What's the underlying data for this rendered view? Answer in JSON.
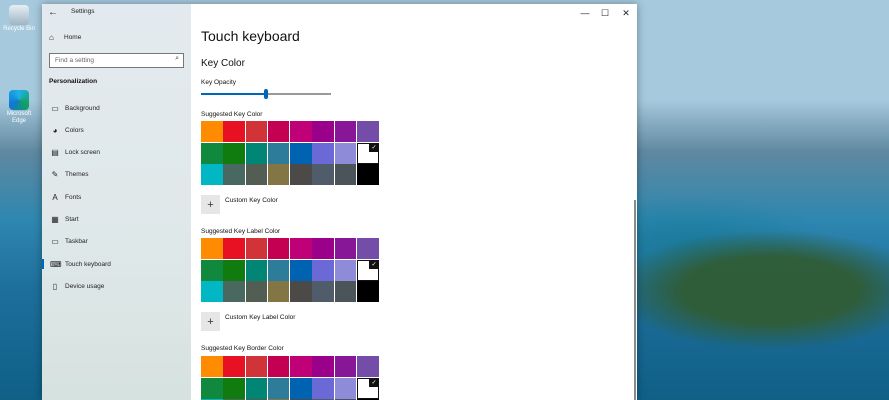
{
  "desktop": {
    "icons": [
      {
        "label": "Recycle Bin",
        "icon": "recycle-bin-icon"
      },
      {
        "label": "Microsoft Edge",
        "icon": "edge-icon"
      }
    ]
  },
  "window": {
    "title": "Settings",
    "controls": {
      "back": "←",
      "minimize": "—",
      "maximize": "☐",
      "close": "✕"
    }
  },
  "sidebar": {
    "home_label": "Home",
    "search_placeholder": "Find a setting",
    "section": "Personalization",
    "items": [
      {
        "label": "Background",
        "icon": "image-icon",
        "glyph": "▭"
      },
      {
        "label": "Colors",
        "icon": "palette-icon",
        "glyph": "◕"
      },
      {
        "label": "Lock screen",
        "icon": "lock-screen-icon",
        "glyph": "▤"
      },
      {
        "label": "Themes",
        "icon": "brush-icon",
        "glyph": "✎"
      },
      {
        "label": "Fonts",
        "icon": "font-icon",
        "glyph": "A"
      },
      {
        "label": "Start",
        "icon": "start-icon",
        "glyph": "▦"
      },
      {
        "label": "Taskbar",
        "icon": "taskbar-icon",
        "glyph": "▭"
      },
      {
        "label": "Touch keyboard",
        "icon": "keyboard-icon",
        "glyph": "⌨",
        "active": true
      },
      {
        "label": "Device usage",
        "icon": "device-icon",
        "glyph": "▯"
      }
    ]
  },
  "main": {
    "title": "Touch keyboard",
    "section_title": "Key Color",
    "opacity_label": "Key Opacity",
    "opacity_value": 0.5,
    "groups": [
      {
        "label": "Suggested Key Color",
        "custom_label": "Custom Key Color"
      },
      {
        "label": "Suggested Key Label Color",
        "custom_label": "Custom Key Label Color"
      },
      {
        "label": "Suggested Key Border Color",
        "custom_label": ""
      }
    ],
    "palette": [
      "#ff8c00",
      "#e81123",
      "#d13438",
      "#c30052",
      "#bf0077",
      "#9a0089",
      "#881798",
      "#744da9",
      "#10893e",
      "#107c10",
      "#018574",
      "#2d7d9a",
      "#0063b1",
      "#6b69d6",
      "#8e8cd8",
      "#ffffff",
      "#00b7c3",
      "#486860",
      "#525e54",
      "#847545",
      "#4c4a48",
      "#515c6b",
      "#4a5459",
      "#000000"
    ],
    "selected_index": 15
  }
}
